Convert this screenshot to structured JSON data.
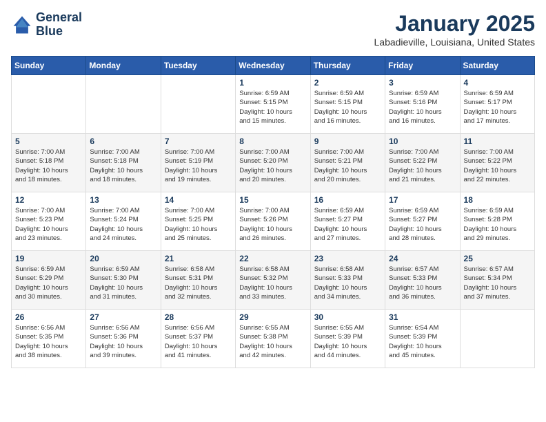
{
  "header": {
    "logo_line1": "General",
    "logo_line2": "Blue",
    "month_title": "January 2025",
    "location": "Labadieville, Louisiana, United States"
  },
  "weekdays": [
    "Sunday",
    "Monday",
    "Tuesday",
    "Wednesday",
    "Thursday",
    "Friday",
    "Saturday"
  ],
  "weeks": [
    [
      {
        "day": "",
        "info": ""
      },
      {
        "day": "",
        "info": ""
      },
      {
        "day": "",
        "info": ""
      },
      {
        "day": "1",
        "info": "Sunrise: 6:59 AM\nSunset: 5:15 PM\nDaylight: 10 hours\nand 15 minutes."
      },
      {
        "day": "2",
        "info": "Sunrise: 6:59 AM\nSunset: 5:15 PM\nDaylight: 10 hours\nand 16 minutes."
      },
      {
        "day": "3",
        "info": "Sunrise: 6:59 AM\nSunset: 5:16 PM\nDaylight: 10 hours\nand 16 minutes."
      },
      {
        "day": "4",
        "info": "Sunrise: 6:59 AM\nSunset: 5:17 PM\nDaylight: 10 hours\nand 17 minutes."
      }
    ],
    [
      {
        "day": "5",
        "info": "Sunrise: 7:00 AM\nSunset: 5:18 PM\nDaylight: 10 hours\nand 18 minutes."
      },
      {
        "day": "6",
        "info": "Sunrise: 7:00 AM\nSunset: 5:18 PM\nDaylight: 10 hours\nand 18 minutes."
      },
      {
        "day": "7",
        "info": "Sunrise: 7:00 AM\nSunset: 5:19 PM\nDaylight: 10 hours\nand 19 minutes."
      },
      {
        "day": "8",
        "info": "Sunrise: 7:00 AM\nSunset: 5:20 PM\nDaylight: 10 hours\nand 20 minutes."
      },
      {
        "day": "9",
        "info": "Sunrise: 7:00 AM\nSunset: 5:21 PM\nDaylight: 10 hours\nand 20 minutes."
      },
      {
        "day": "10",
        "info": "Sunrise: 7:00 AM\nSunset: 5:22 PM\nDaylight: 10 hours\nand 21 minutes."
      },
      {
        "day": "11",
        "info": "Sunrise: 7:00 AM\nSunset: 5:22 PM\nDaylight: 10 hours\nand 22 minutes."
      }
    ],
    [
      {
        "day": "12",
        "info": "Sunrise: 7:00 AM\nSunset: 5:23 PM\nDaylight: 10 hours\nand 23 minutes."
      },
      {
        "day": "13",
        "info": "Sunrise: 7:00 AM\nSunset: 5:24 PM\nDaylight: 10 hours\nand 24 minutes."
      },
      {
        "day": "14",
        "info": "Sunrise: 7:00 AM\nSunset: 5:25 PM\nDaylight: 10 hours\nand 25 minutes."
      },
      {
        "day": "15",
        "info": "Sunrise: 7:00 AM\nSunset: 5:26 PM\nDaylight: 10 hours\nand 26 minutes."
      },
      {
        "day": "16",
        "info": "Sunrise: 6:59 AM\nSunset: 5:27 PM\nDaylight: 10 hours\nand 27 minutes."
      },
      {
        "day": "17",
        "info": "Sunrise: 6:59 AM\nSunset: 5:27 PM\nDaylight: 10 hours\nand 28 minutes."
      },
      {
        "day": "18",
        "info": "Sunrise: 6:59 AM\nSunset: 5:28 PM\nDaylight: 10 hours\nand 29 minutes."
      }
    ],
    [
      {
        "day": "19",
        "info": "Sunrise: 6:59 AM\nSunset: 5:29 PM\nDaylight: 10 hours\nand 30 minutes."
      },
      {
        "day": "20",
        "info": "Sunrise: 6:59 AM\nSunset: 5:30 PM\nDaylight: 10 hours\nand 31 minutes."
      },
      {
        "day": "21",
        "info": "Sunrise: 6:58 AM\nSunset: 5:31 PM\nDaylight: 10 hours\nand 32 minutes."
      },
      {
        "day": "22",
        "info": "Sunrise: 6:58 AM\nSunset: 5:32 PM\nDaylight: 10 hours\nand 33 minutes."
      },
      {
        "day": "23",
        "info": "Sunrise: 6:58 AM\nSunset: 5:33 PM\nDaylight: 10 hours\nand 34 minutes."
      },
      {
        "day": "24",
        "info": "Sunrise: 6:57 AM\nSunset: 5:33 PM\nDaylight: 10 hours\nand 36 minutes."
      },
      {
        "day": "25",
        "info": "Sunrise: 6:57 AM\nSunset: 5:34 PM\nDaylight: 10 hours\nand 37 minutes."
      }
    ],
    [
      {
        "day": "26",
        "info": "Sunrise: 6:56 AM\nSunset: 5:35 PM\nDaylight: 10 hours\nand 38 minutes."
      },
      {
        "day": "27",
        "info": "Sunrise: 6:56 AM\nSunset: 5:36 PM\nDaylight: 10 hours\nand 39 minutes."
      },
      {
        "day": "28",
        "info": "Sunrise: 6:56 AM\nSunset: 5:37 PM\nDaylight: 10 hours\nand 41 minutes."
      },
      {
        "day": "29",
        "info": "Sunrise: 6:55 AM\nSunset: 5:38 PM\nDaylight: 10 hours\nand 42 minutes."
      },
      {
        "day": "30",
        "info": "Sunrise: 6:55 AM\nSunset: 5:39 PM\nDaylight: 10 hours\nand 44 minutes."
      },
      {
        "day": "31",
        "info": "Sunrise: 6:54 AM\nSunset: 5:39 PM\nDaylight: 10 hours\nand 45 minutes."
      },
      {
        "day": "",
        "info": ""
      }
    ]
  ]
}
